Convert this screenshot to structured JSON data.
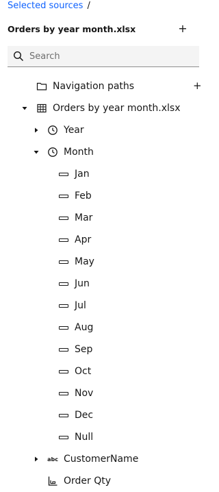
{
  "breadcrumb": {
    "link": "Selected sources",
    "separator": "/"
  },
  "panel": {
    "title": "Orders by year month.xlsx",
    "add_symbol": "+"
  },
  "search": {
    "placeholder": "Search"
  },
  "tree": {
    "navigation_paths": {
      "label": "Navigation paths",
      "add_symbol": "+"
    },
    "source": {
      "label": "Orders by year month.xlsx",
      "expanded": true
    },
    "year": {
      "label": "Year",
      "expanded": false
    },
    "month": {
      "label": "Month",
      "expanded": true,
      "members": [
        "Jan",
        "Feb",
        "Mar",
        "Apr",
        "May",
        "Jun",
        "Jul",
        "Aug",
        "Sep",
        "Oct",
        "Nov",
        "Dec",
        "Null"
      ]
    },
    "customer_name": {
      "label": "CustomerName",
      "type_badge": "abc",
      "expanded": false
    },
    "order_qty": {
      "label": "Order Qty"
    }
  }
}
